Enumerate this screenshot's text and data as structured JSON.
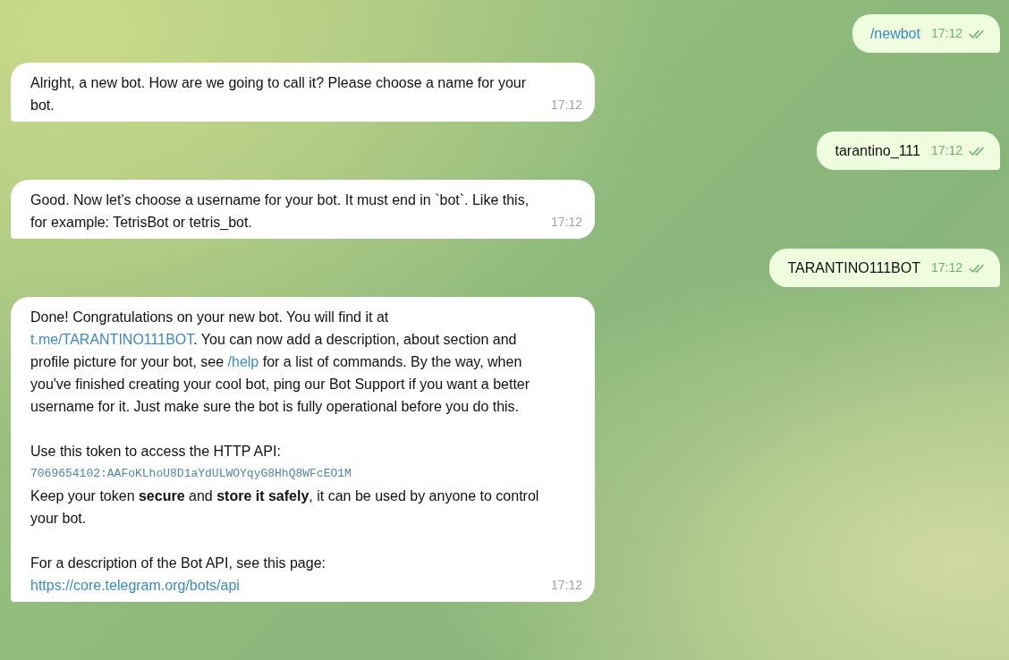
{
  "messages": [
    {
      "kind": "outgoing",
      "read": true,
      "time": "17:12",
      "paragraphs": [
        [
          {
            "kind": "text",
            "parts": [
              {
                "kind": "link",
                "text": "/newbot"
              }
            ]
          }
        ]
      ]
    },
    {
      "kind": "incoming",
      "time": "17:12",
      "paragraphs": [
        [
          {
            "kind": "text",
            "parts": [
              {
                "kind": "plain",
                "text": "Alright, a new bot. How are we going to call it? Please choose a name for your bot."
              }
            ]
          }
        ]
      ]
    },
    {
      "kind": "outgoing",
      "read": true,
      "time": "17:12",
      "paragraphs": [
        [
          {
            "kind": "text",
            "parts": [
              {
                "kind": "plain",
                "text": "tarantino_111"
              }
            ]
          }
        ]
      ]
    },
    {
      "kind": "incoming",
      "time": "17:12",
      "paragraphs": [
        [
          {
            "kind": "text",
            "parts": [
              {
                "kind": "plain",
                "text": "Good. Now let's choose a username for your bot. It must end in `bot`. Like this, for example: TetrisBot or tetris_bot."
              }
            ]
          }
        ]
      ]
    },
    {
      "kind": "outgoing",
      "read": true,
      "time": "17:12",
      "paragraphs": [
        [
          {
            "kind": "text",
            "parts": [
              {
                "kind": "plain",
                "text": "TARANTINO111BOT"
              }
            ]
          }
        ]
      ]
    },
    {
      "kind": "incoming",
      "time": "17:12",
      "paragraphs": [
        [
          {
            "kind": "text",
            "parts": [
              {
                "kind": "plain",
                "text": "Done! Congratulations on your new bot. You will find it at "
              },
              {
                "kind": "link",
                "text": "t.me/TARANTINO111BOT"
              },
              {
                "kind": "plain",
                "text": ". You can now add a description, about section and profile picture for your bot, see "
              },
              {
                "kind": "link",
                "text": "/help"
              },
              {
                "kind": "plain",
                "text": " for a list of commands. By the way, when you've finished creating your cool bot, ping our Bot Support if you want a better username for it. Just make sure the bot is fully operational before you do this."
              }
            ]
          }
        ],
        [
          {
            "kind": "text",
            "parts": [
              {
                "kind": "plain",
                "text": "Use this token to access the HTTP API:"
              }
            ]
          },
          {
            "kind": "code",
            "text": "7069654102:AAFoKLhoU8D1aYdULWOYqyG8HhQ8WFcEO1M"
          },
          {
            "kind": "text",
            "parts": [
              {
                "kind": "plain",
                "text": "Keep your token **secure** and **store it safely**, it can be used by anyone to control your bot."
              }
            ]
          }
        ],
        [
          {
            "kind": "text",
            "parts": [
              {
                "kind": "plain",
                "text": "For a description of the Bot API, see this page:"
              }
            ]
          },
          {
            "kind": "text",
            "parts": [
              {
                "kind": "link",
                "text": "https://core.telegram.org/bots/api"
              }
            ]
          }
        ]
      ]
    }
  ]
}
